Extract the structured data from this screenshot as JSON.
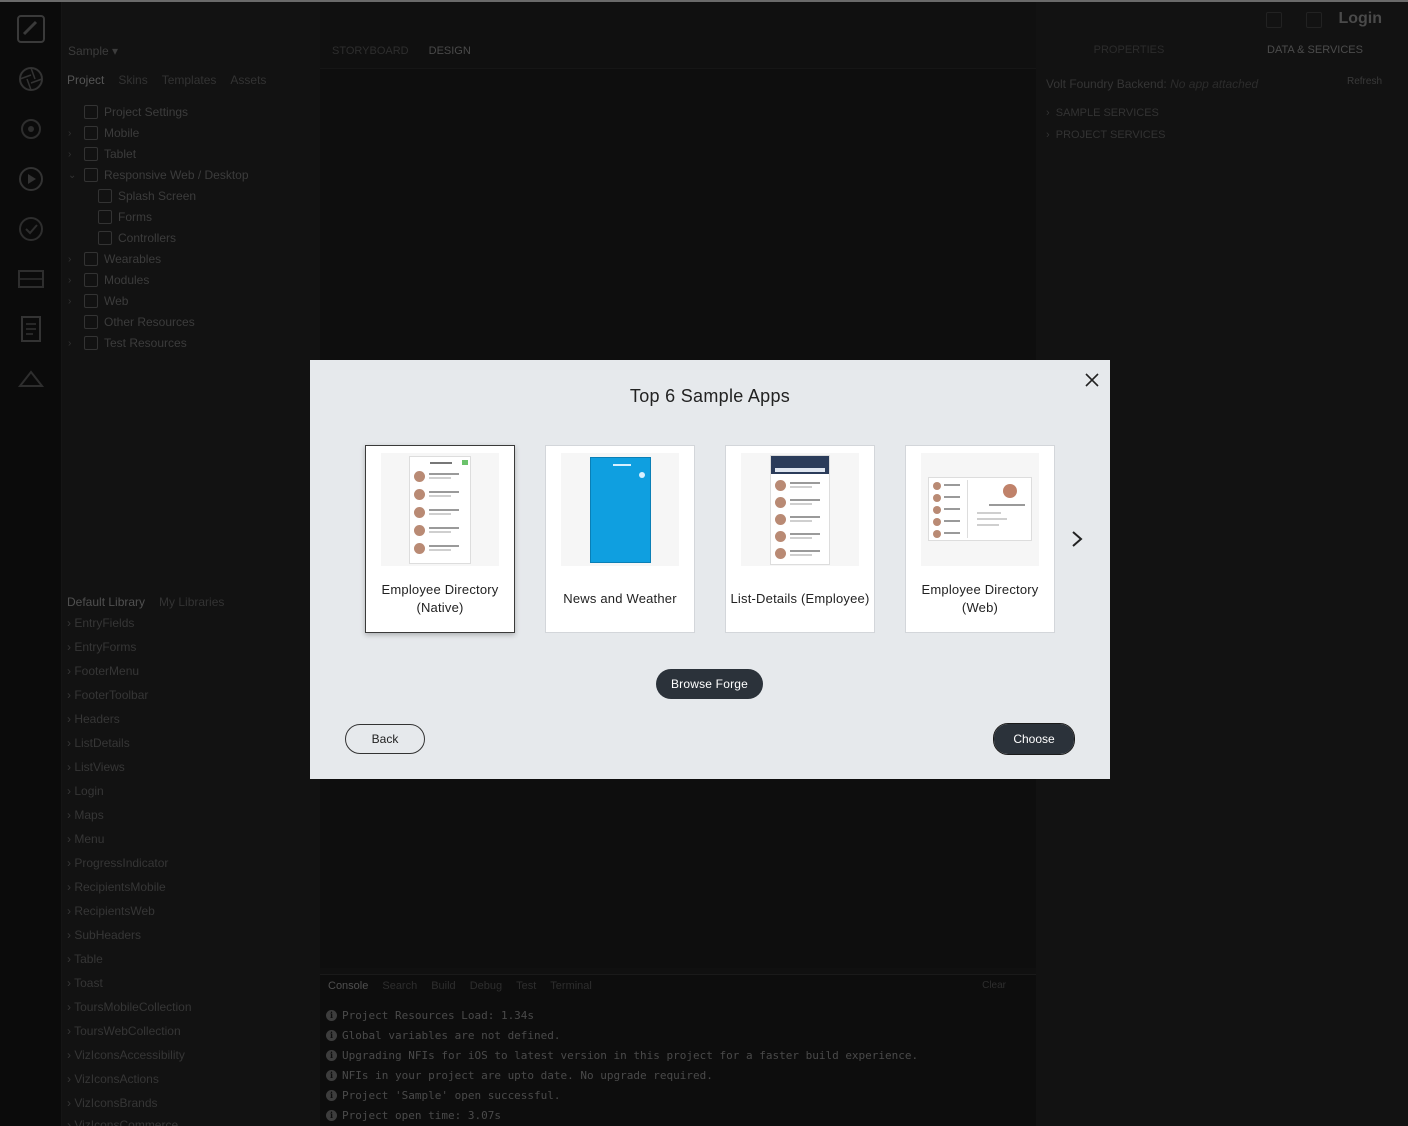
{
  "ide": {
    "login_label": "Login",
    "project": {
      "title": "Sample",
      "tabs": [
        "Project",
        "Skins",
        "Templates",
        "Assets"
      ],
      "tree": [
        {
          "label": "Project Settings",
          "indent": 0,
          "chevron": ""
        },
        {
          "label": "Mobile",
          "indent": 0,
          "chevron": ">"
        },
        {
          "label": "Tablet",
          "indent": 0,
          "chevron": ">"
        },
        {
          "label": "Responsive Web / Desktop",
          "indent": 0,
          "chevron": "v"
        },
        {
          "label": "Splash Screen",
          "indent": 1,
          "chevron": ""
        },
        {
          "label": "Forms",
          "indent": 1,
          "chevron": ""
        },
        {
          "label": "Controllers",
          "indent": 1,
          "chevron": ""
        },
        {
          "label": "Wearables",
          "indent": 0,
          "chevron": ">"
        },
        {
          "label": "Modules",
          "indent": 0,
          "chevron": ">"
        },
        {
          "label": "Web",
          "indent": 0,
          "chevron": ">"
        },
        {
          "label": "Other Resources",
          "indent": 0,
          "chevron": ""
        },
        {
          "label": "Test Resources",
          "indent": 0,
          "chevron": ">"
        }
      ]
    },
    "library": {
      "tabs": [
        "Default Library",
        "My Libraries"
      ],
      "items": [
        "EntryFields",
        "EntryForms",
        "FooterMenu",
        "FooterToolbar",
        "Headers",
        "ListDetails",
        "ListViews",
        "Login",
        "Maps",
        "Menu",
        "ProgressIndicator",
        "RecipientsMobile",
        "RecipientsWeb",
        "SubHeaders",
        "Table",
        "Toast",
        "ToursMobileCollection",
        "ToursWebCollection",
        "VizIconsAccessibility",
        "VizIconsActions",
        "VizIconsBrands",
        "VizIconsCommerce"
      ]
    },
    "center_tabs": [
      "STORYBOARD",
      "DESIGN"
    ],
    "console": {
      "tabs": [
        "Console",
        "Search",
        "Build",
        "Debug",
        "Test",
        "Terminal"
      ],
      "clear_label": "Clear",
      "lines": [
        "Project Resources Load: 1.34s",
        "Global variables are not defined.",
        "Upgrading NFIs for iOS to latest version in this project for a faster build experience.",
        "NFIs in your project are upto date. No upgrade required.",
        "Project 'Sample' open successful.",
        "Project open time: 3.07s"
      ]
    },
    "right": {
      "tabs": [
        "PROPERTIES",
        "DATA & SERVICES"
      ],
      "backend_label": "Volt Foundry Backend:",
      "backend_value": "No app attached",
      "refresh_label": "Refresh",
      "services": [
        "SAMPLE SERVICES",
        "PROJECT SERVICES"
      ]
    }
  },
  "modal": {
    "title": "Top 6 Sample Apps",
    "cards": [
      {
        "label": "Employee Directory (Native)",
        "selected": true,
        "thumb": "employee-native"
      },
      {
        "label": "News and Weather",
        "selected": false,
        "thumb": "news-weather"
      },
      {
        "label": "List-Details (Employee)",
        "selected": false,
        "thumb": "list-details"
      },
      {
        "label": "Employee Directory (Web)",
        "selected": false,
        "thumb": "employee-web"
      }
    ],
    "browse_label": "Browse Forge",
    "back_label": "Back",
    "choose_label": "Choose"
  },
  "icons": {
    "close": "close-icon",
    "next": "chevron-right-icon"
  },
  "colors": {
    "modal_bg": "#e6e9ec",
    "primary_button": "#2b323a",
    "news_blue": "#0f9fe0",
    "list_header": "#2b3c5a"
  }
}
